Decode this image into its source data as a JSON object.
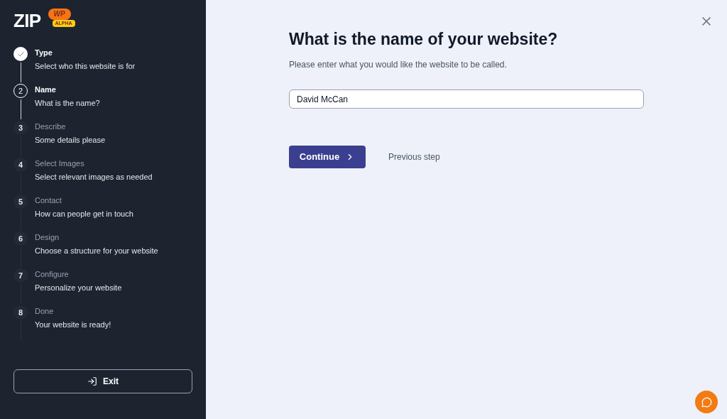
{
  "logo": {
    "main": "ZIP",
    "badge": "WP",
    "tag": "ALPHA"
  },
  "steps": [
    {
      "kind": "done",
      "title": "Type",
      "subtitle": "Select who this website is for"
    },
    {
      "kind": "current",
      "number": "2",
      "title": "Name",
      "subtitle": "What is the name?"
    },
    {
      "kind": "upcoming",
      "number": "3",
      "title": "Describe",
      "subtitle": "Some details please"
    },
    {
      "kind": "upcoming",
      "number": "4",
      "title": "Select Images",
      "subtitle": "Select relevant images as needed"
    },
    {
      "kind": "upcoming",
      "number": "5",
      "title": "Contact",
      "subtitle": "How can people get in touch"
    },
    {
      "kind": "upcoming",
      "number": "6",
      "title": "Design",
      "subtitle": "Choose a structure for your website"
    },
    {
      "kind": "upcoming",
      "number": "7",
      "title": "Configure",
      "subtitle": "Personalize your website"
    },
    {
      "kind": "upcoming",
      "number": "8",
      "title": "Done",
      "subtitle": "Your website is ready!"
    }
  ],
  "exit_button": "Exit",
  "heading": "What is the name of your website?",
  "description": "Please enter what you would like the website to be called.",
  "name_field": {
    "value": "David McCan"
  },
  "continue_button": "Continue",
  "previous_link": "Previous step"
}
